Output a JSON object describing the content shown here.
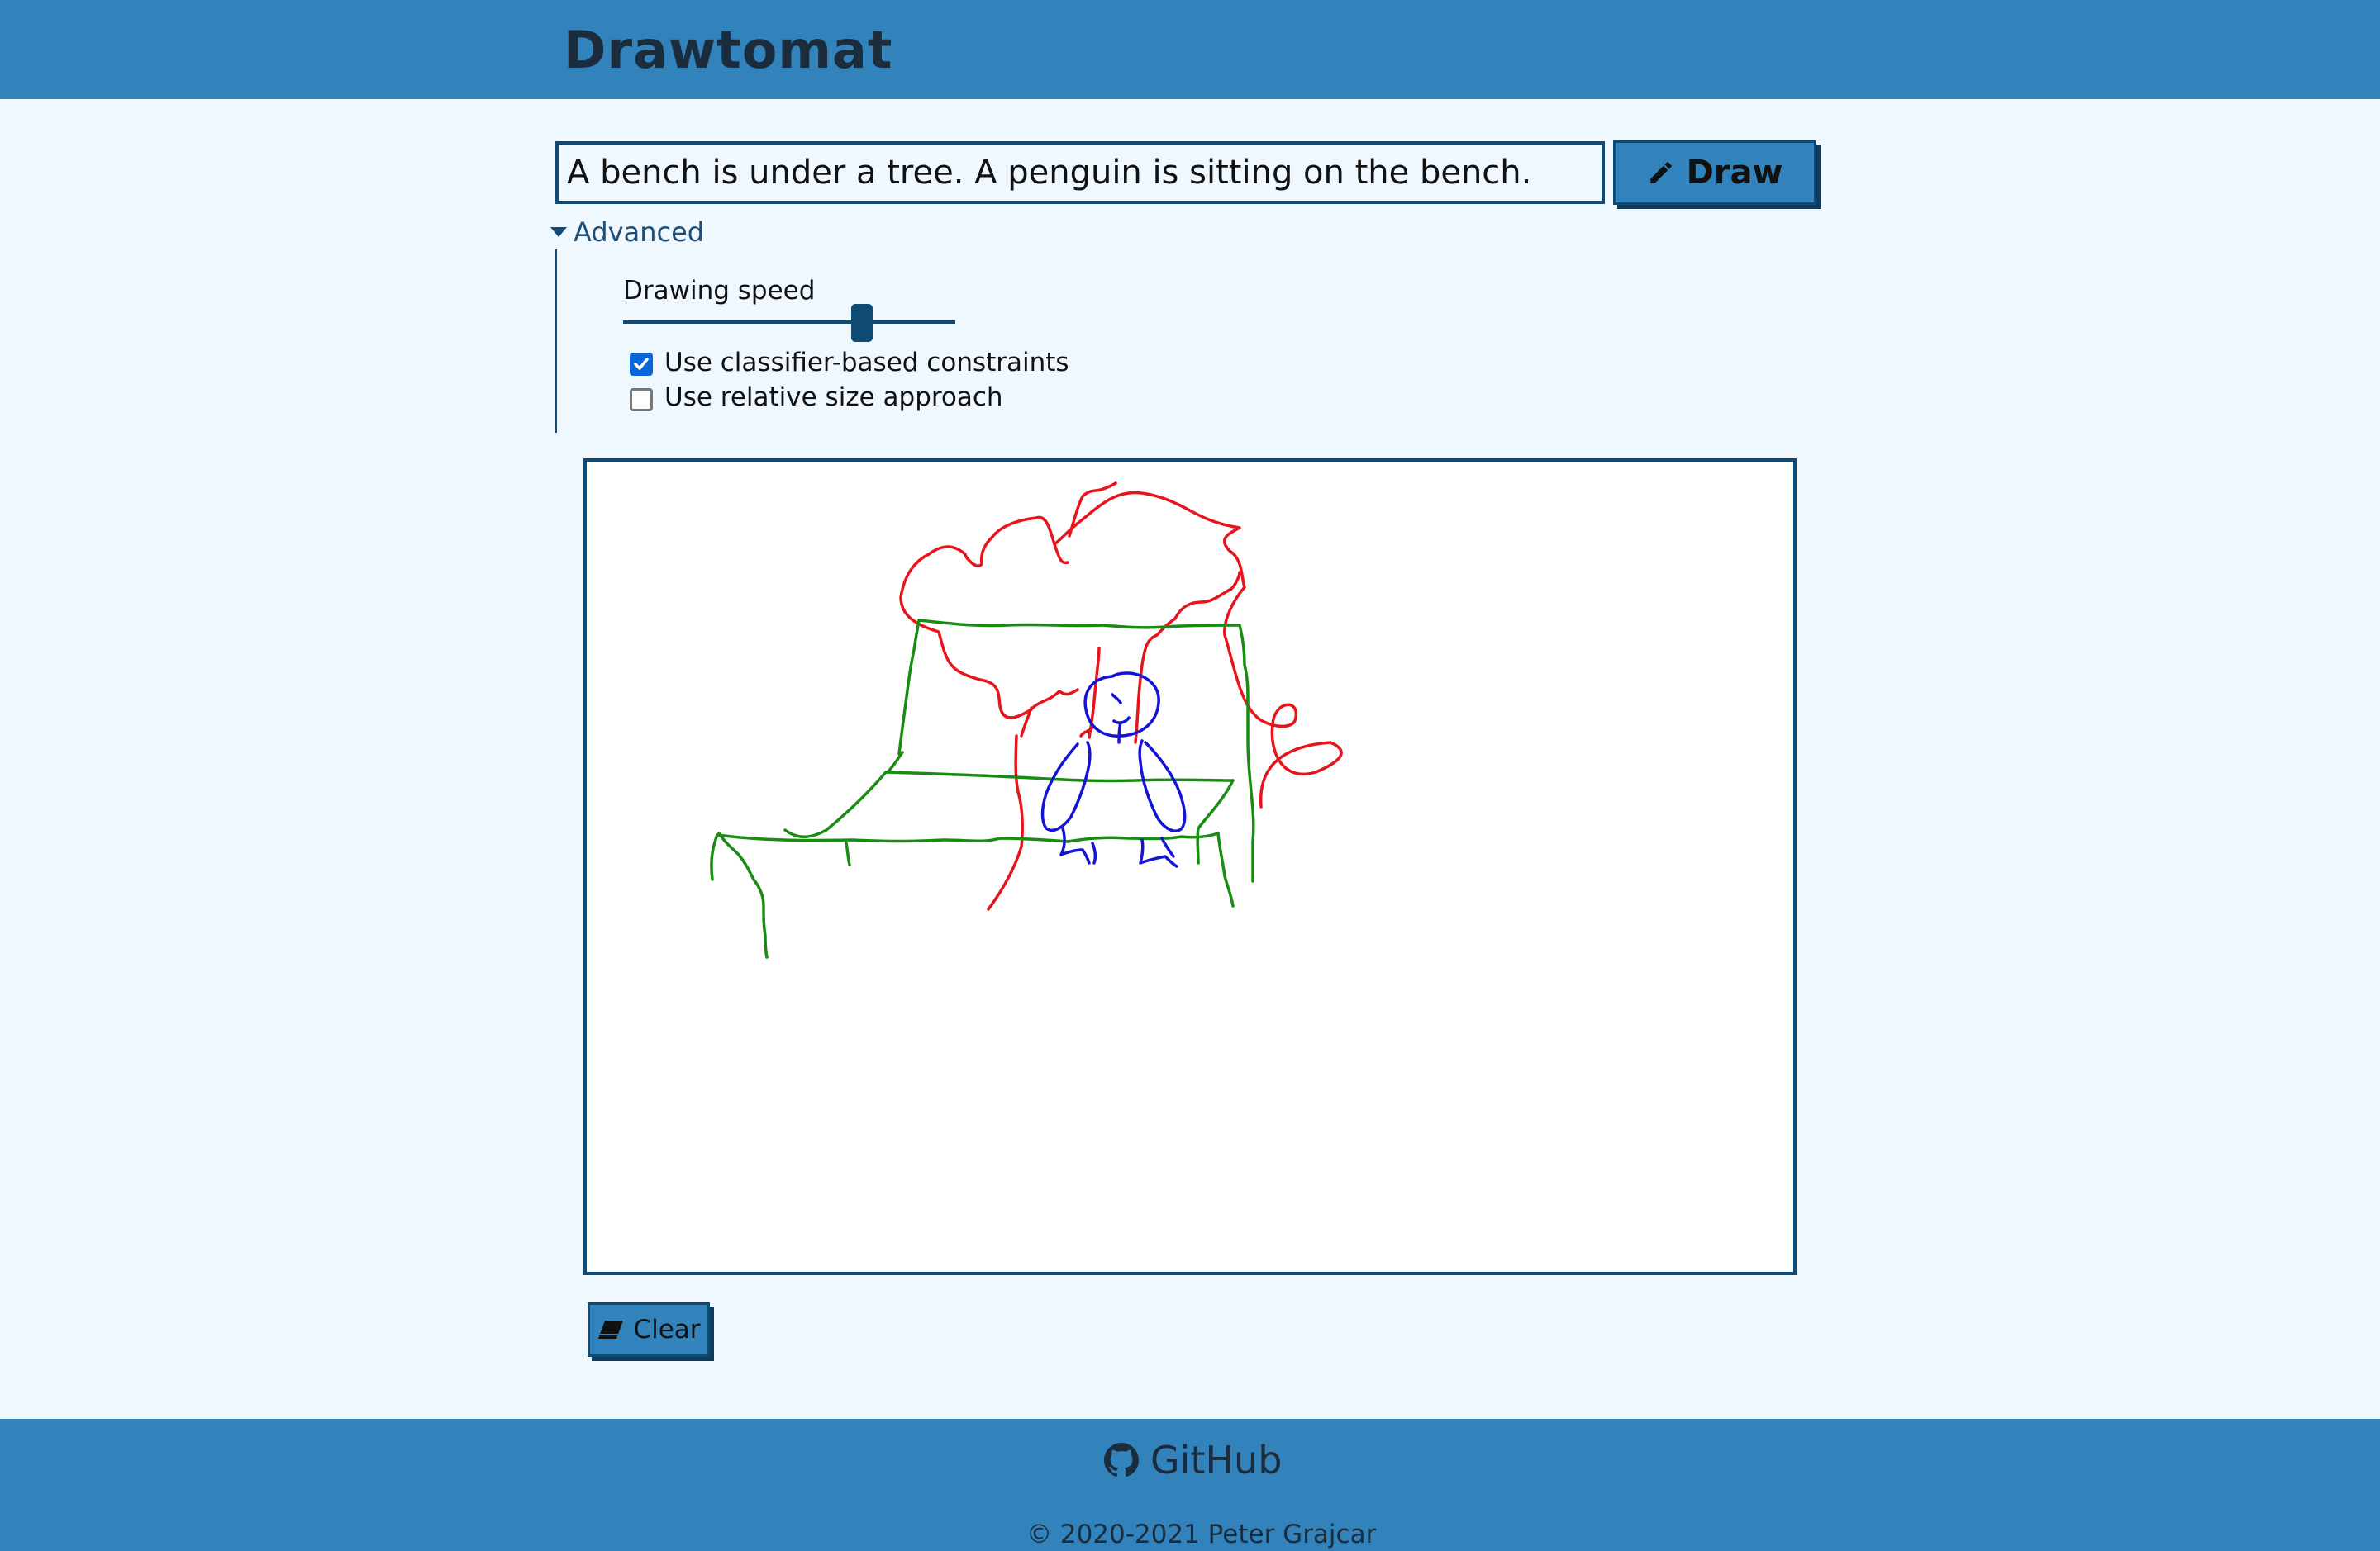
{
  "app": {
    "title": "Drawtomat"
  },
  "prompt": {
    "value": "A bench is under a tree. A penguin is sitting on the bench."
  },
  "buttons": {
    "draw_label": "Draw",
    "clear_label": "Clear"
  },
  "advanced": {
    "label": "Advanced",
    "expanded": true,
    "speed_label": "Drawing speed",
    "speed_level": 0.72,
    "options": [
      {
        "label": "Use classifier-based constraints",
        "checked": true
      },
      {
        "label": "Use relative size approach",
        "checked": false
      }
    ]
  },
  "footer": {
    "github_label": "GitHub",
    "copyright": "© 2020-2021 Peter Grajcar"
  },
  "icons": {
    "draw": "pencil-icon",
    "clear": "eraser-icon",
    "github": "github-icon",
    "advanced": "caret-down-icon"
  },
  "colors": {
    "brand": "#3282bb",
    "dark": "#0e4a73",
    "background": "#eff8fe",
    "tree": "#e8141c",
    "bench": "#1a8c14",
    "penguin": "#1414d6"
  }
}
